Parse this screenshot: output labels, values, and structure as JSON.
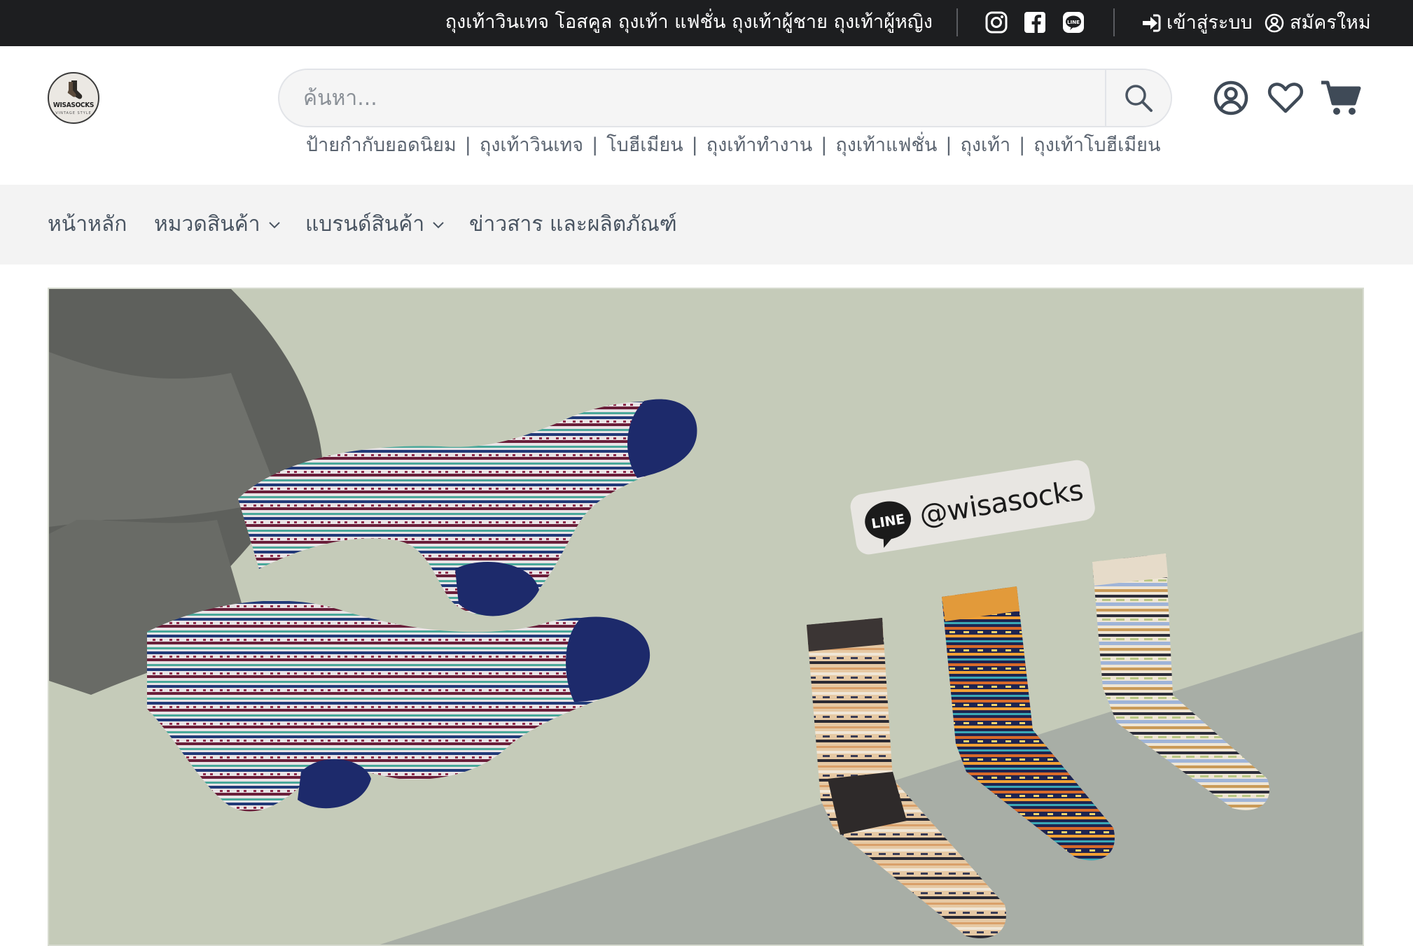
{
  "topbar": {
    "tagline": "ถุงเท้าวินเทจ โอสคูล ถุงเท้า แฟชั่น ถุงเท้าผู้ชาย ถุงเท้าผู้หญิง",
    "login_label": "เข้าสู่ระบบ",
    "register_label": "สมัครใหม่",
    "social_icons": [
      "instagram-icon",
      "facebook-icon",
      "line-icon"
    ]
  },
  "header": {
    "logo_text": "WISASOCKS",
    "logo_subtext": "VINTAGE STYLE",
    "search_placeholder": "ค้นหา...",
    "icons": [
      "account-icon",
      "wishlist-icon",
      "cart-icon"
    ]
  },
  "popular_tags": [
    "ป้ายกำกับยอดนิยม",
    "ถุงเท้าวินเทจ",
    "โบฮีเมียน",
    "ถุงเท้าทำงาน",
    "ถุงเท้าแฟชั่น",
    "ถุงเท้า",
    "ถุงเท้าโบฮีเมียน"
  ],
  "nav": {
    "home": "หน้าหลัก",
    "categories": "หมวดสินค้า",
    "brands": "แบรนด์สินค้า",
    "news": "ข่าวสาร และผลิตภัณฑ์"
  },
  "banner": {
    "line_label": "LINE",
    "line_handle": "@wisasocks"
  },
  "colors": {
    "topbar_bg": "#1d1e20",
    "nav_bg": "#f3f3f3",
    "banner_bg": "#c5cbb9",
    "banner_floor": "#a8aea6",
    "sock_navy": "#1d2a6b"
  }
}
